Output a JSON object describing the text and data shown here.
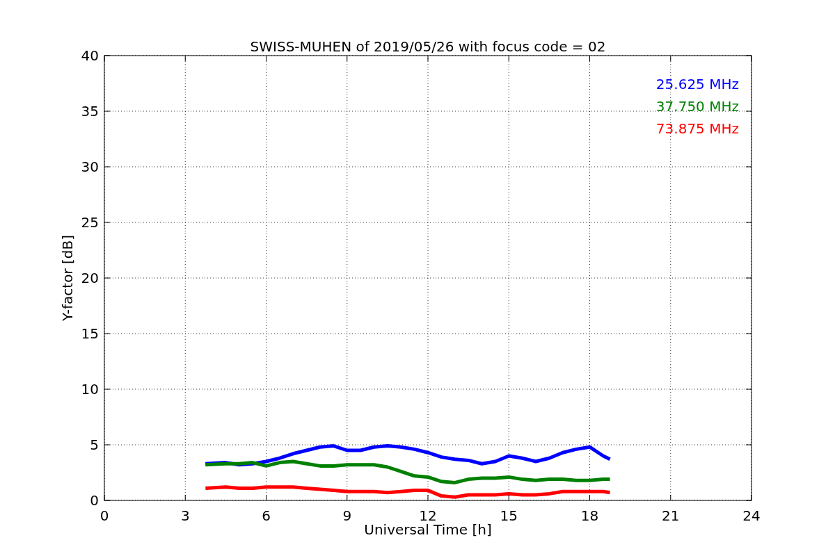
{
  "chart_data": {
    "type": "line",
    "title": "SWISS-MUHEN of 2019/05/26 with focus code = 02",
    "xlabel": "Universal Time [h]",
    "ylabel": "Y-factor [dB]",
    "x": [
      3.75,
      4.5,
      5,
      5.5,
      6,
      6.5,
      7,
      7.5,
      8,
      8.5,
      9,
      9.5,
      10,
      10.5,
      11,
      11.5,
      12,
      12.5,
      13,
      13.5,
      14,
      14.5,
      15,
      15.5,
      16,
      16.5,
      17,
      17.5,
      18,
      18.5,
      18.75
    ],
    "series": [
      {
        "name": "25.625 MHz",
        "color": "#0000ff",
        "values": [
          3.3,
          3.4,
          3.2,
          3.3,
          3.5,
          3.8,
          4.2,
          4.5,
          4.8,
          4.9,
          4.5,
          4.5,
          4.8,
          4.9,
          4.8,
          4.6,
          4.3,
          3.9,
          3.7,
          3.6,
          3.3,
          3.5,
          4.0,
          3.8,
          3.5,
          3.8,
          4.3,
          4.6,
          4.8,
          4.0,
          3.7
        ]
      },
      {
        "name": "37.750 MHz",
        "color": "#008000",
        "values": [
          3.2,
          3.3,
          3.3,
          3.4,
          3.1,
          3.4,
          3.5,
          3.3,
          3.1,
          3.1,
          3.2,
          3.2,
          3.2,
          3.0,
          2.6,
          2.2,
          2.1,
          1.7,
          1.6,
          1.9,
          2.0,
          2.0,
          2.1,
          1.9,
          1.8,
          1.9,
          1.9,
          1.8,
          1.8,
          1.9,
          1.9
        ]
      },
      {
        "name": "73.875 MHz",
        "color": "#ff0000",
        "values": [
          1.1,
          1.2,
          1.1,
          1.1,
          1.2,
          1.2,
          1.2,
          1.1,
          1.0,
          0.9,
          0.8,
          0.8,
          0.8,
          0.7,
          0.8,
          0.9,
          0.9,
          0.4,
          0.3,
          0.5,
          0.5,
          0.5,
          0.6,
          0.5,
          0.5,
          0.6,
          0.8,
          0.8,
          0.8,
          0.8,
          0.7
        ]
      }
    ],
    "xlim": [
      0,
      24
    ],
    "ylim": [
      0,
      40
    ],
    "xticks": [
      0,
      3,
      6,
      9,
      12,
      15,
      18,
      21,
      24
    ],
    "yticks": [
      0,
      5,
      10,
      15,
      20,
      25,
      30,
      35,
      40
    ],
    "grid": true
  }
}
